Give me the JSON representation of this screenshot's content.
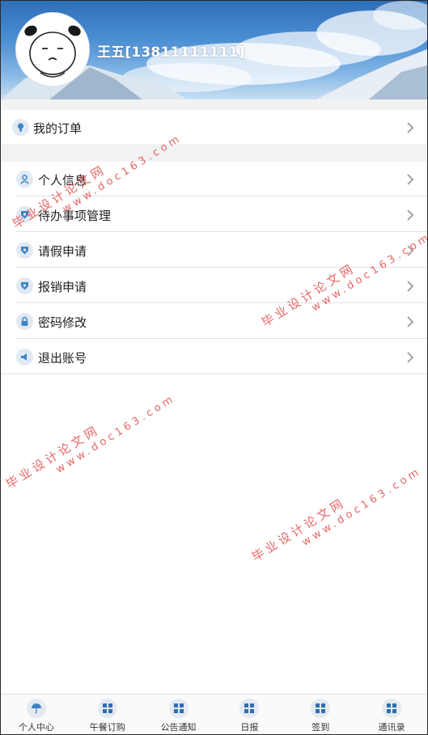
{
  "profile": {
    "name": "王五[13811111111]"
  },
  "orders": {
    "label": "我的订单",
    "icon": "lightbulb-icon"
  },
  "menu": [
    {
      "label": "个人信息",
      "icon": "user-icon"
    },
    {
      "label": "待办事项管理",
      "icon": "badge-icon"
    },
    {
      "label": "请假申请",
      "icon": "badge-icon"
    },
    {
      "label": "报销申请",
      "icon": "badge-icon"
    },
    {
      "label": "密码修改",
      "icon": "lock-icon"
    },
    {
      "label": "退出账号",
      "icon": "speaker-icon"
    }
  ],
  "watermark": {
    "cn": "毕业设计论文网",
    "url": "www.doc163.com"
  },
  "bottom_nav": [
    {
      "label": "个人中心",
      "icon": "umbrella-icon"
    },
    {
      "label": "午餐订购",
      "icon": "grid-icon"
    },
    {
      "label": "公告通知",
      "icon": "grid-icon"
    },
    {
      "label": "日报",
      "icon": "grid-icon"
    },
    {
      "label": "签到",
      "icon": "grid-icon"
    },
    {
      "label": "通讯录",
      "icon": "grid-icon"
    }
  ],
  "colors": {
    "accent": "#3a86c8",
    "watermark": "#e03a3a"
  }
}
